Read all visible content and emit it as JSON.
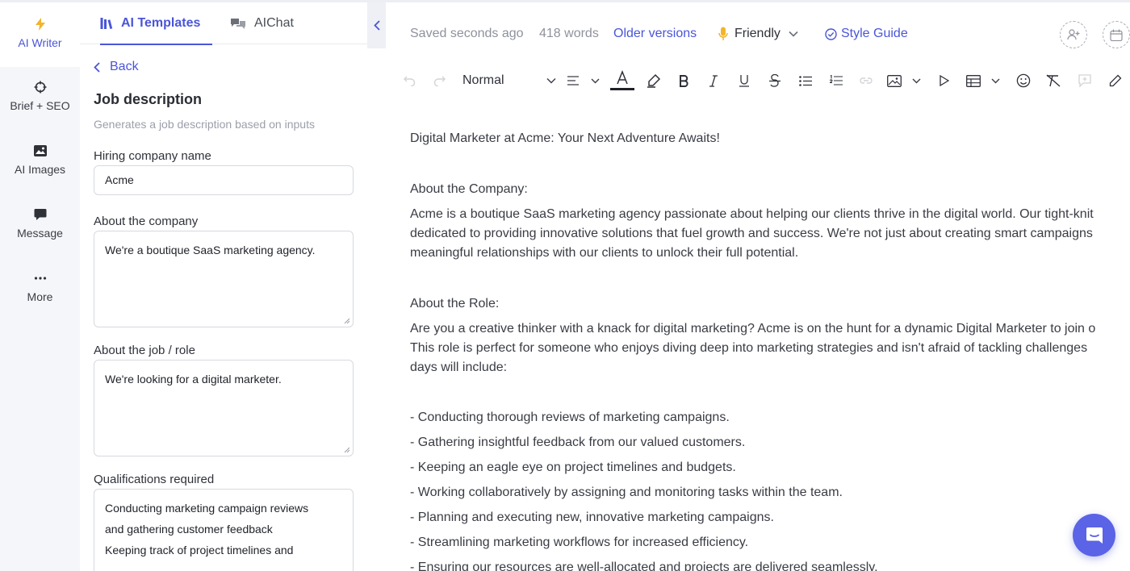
{
  "rail": {
    "items": [
      {
        "label": "AI Writer",
        "icon": "lightning-icon"
      },
      {
        "label": "Brief + SEO",
        "icon": "crosshair-icon"
      },
      {
        "label": "AI Images",
        "icon": "image-icon"
      },
      {
        "label": "Message",
        "icon": "chat-bubble-icon"
      },
      {
        "label": "More",
        "icon": "ellipsis-icon"
      }
    ]
  },
  "panel": {
    "tabs": [
      {
        "label": "AI Templates",
        "icon": "books-icon"
      },
      {
        "label": "AIChat",
        "icon": "chat-bubbles-icon"
      }
    ],
    "back_label": "Back",
    "title": "Job description",
    "subtitle": "Generates a job description based on inputs",
    "fields": {
      "company_name": {
        "label": "Hiring company name",
        "value": "Acme"
      },
      "about_company": {
        "label": "About the company",
        "value": "We're a boutique SaaS marketing agency."
      },
      "about_job": {
        "label": "About the job / role",
        "value": "We're looking for a digital marketer."
      },
      "qualifications": {
        "label": "Qualifications required",
        "lines": [
          "Conducting marketing campaign reviews",
          "and gathering customer feedback",
          "Keeping track of project timelines and"
        ]
      }
    }
  },
  "editor": {
    "status": {
      "saved": "Saved seconds ago",
      "words": "418 words",
      "older_versions": "Older versions",
      "tone": "Friendly",
      "style_guide": "Style Guide"
    },
    "toolbar": {
      "block_style": "Normal"
    },
    "document": {
      "headline": "Digital Marketer at Acme: Your Next Adventure Awaits!",
      "company_heading": "About the Company:",
      "company_lines": [
        "Acme is a boutique SaaS marketing agency passionate about helping our clients thrive in the digital world. Our tight-knit",
        "dedicated to providing innovative solutions that fuel growth and success. We're not just about creating smart campaigns",
        "meaningful relationships with our clients to unlock their full potential."
      ],
      "role_heading": "About the Role:",
      "role_lines": [
        "Are you a creative thinker with a knack for digital marketing? Acme is on the hunt for a dynamic Digital Marketer to join o",
        "This role is perfect for someone who enjoys diving deep into marketing strategies and isn't afraid of tackling challenges",
        "days will include:"
      ],
      "bullets": [
        "- Conducting thorough reviews of marketing campaigns.",
        "- Gathering insightful feedback from our valued customers.",
        "- Keeping an eagle eye on project timelines and budgets.",
        "- Working collaboratively by assigning and monitoring tasks within the team.",
        "- Planning and executing new, innovative marketing campaigns.",
        "- Streamlining marketing workflows for increased efficiency.",
        "- Ensuring our resources are well-allocated and projects are delivered seamlessly."
      ]
    }
  },
  "colors": {
    "accent": "#4a55d8",
    "fab": "#5b63e6",
    "rail_bg": "#f5f6f9",
    "lightning": "#f2b52a"
  }
}
